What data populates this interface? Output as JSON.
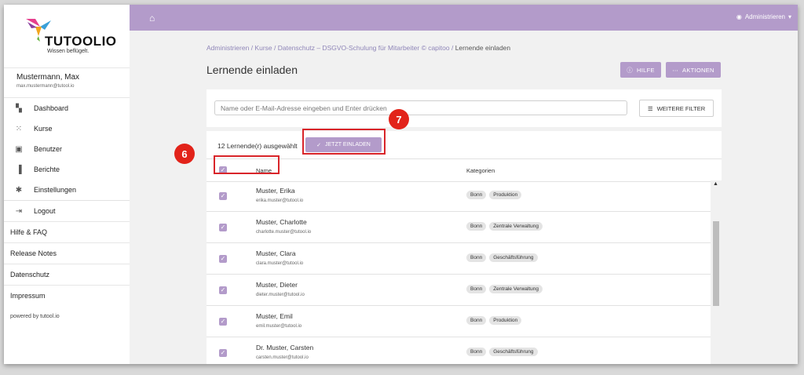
{
  "brand": {
    "name": "TUTOOLIO",
    "tagline": "Wissen beflügelt."
  },
  "user": {
    "name": "Mustermann, Max",
    "email": "max.mustermann@tutool.io"
  },
  "nav": [
    {
      "label": "Dashboard",
      "icon": "dashboard-icon"
    },
    {
      "label": "Kurse",
      "icon": "grid-icon"
    },
    {
      "label": "Benutzer",
      "icon": "person-icon"
    },
    {
      "label": "Berichte",
      "icon": "bar-chart-icon"
    },
    {
      "label": "Einstellungen",
      "icon": "gear-icon"
    },
    {
      "label": "Logout",
      "icon": "logout-icon"
    }
  ],
  "links": [
    "Hilfe & FAQ",
    "Release Notes",
    "Datenschutz",
    "Impressum"
  ],
  "powered": "powered by tutool.io",
  "topbar": {
    "role": "Administrieren"
  },
  "breadcrumb": [
    "Administrieren",
    "Kurse",
    "Datenschutz – DSGVO-Schulung für Mitarbeiter © capitoo",
    "Lernende einladen"
  ],
  "page_title": "Lernende einladen",
  "buttons": {
    "help": "HILFE",
    "actions": "AKTIONEN",
    "filter": "WEITERE FILTER",
    "invite": "JETZT EINLADEN"
  },
  "search": {
    "placeholder": "Name oder E-Mail-Adresse eingeben und Enter drücken"
  },
  "selection": {
    "count_text": "12 Lernende(r) ausgewählt"
  },
  "table": {
    "columns": [
      "Name",
      "Kategorien"
    ],
    "rows": [
      {
        "name": "Muster, Erika",
        "email": "erika.muster@tutool.io",
        "tags": [
          "Bonn",
          "Produktion"
        ]
      },
      {
        "name": "Muster, Charlotte",
        "email": "charlotte.muster@tutool.io",
        "tags": [
          "Bonn",
          "Zentrale Verwaltung"
        ]
      },
      {
        "name": "Muster, Clara",
        "email": "clara.muster@tutool.io",
        "tags": [
          "Bonn",
          "Geschäftsführung"
        ]
      },
      {
        "name": "Muster, Dieter",
        "email": "dieter.muster@tutool.io",
        "tags": [
          "Bonn",
          "Zentrale Verwaltung"
        ]
      },
      {
        "name": "Muster, Emil",
        "email": "emil.muster@tutool.io",
        "tags": [
          "Bonn",
          "Produktion"
        ]
      },
      {
        "name": "Dr. Muster, Carsten",
        "email": "carsten.muster@tutool.io",
        "tags": [
          "Bonn",
          "Geschäftsführung"
        ]
      }
    ]
  },
  "annotations": {
    "step6": "6",
    "step7": "7",
    "color": "#e2231a"
  },
  "colors": {
    "accent": "#b39bca",
    "link": "#8f86b8"
  }
}
